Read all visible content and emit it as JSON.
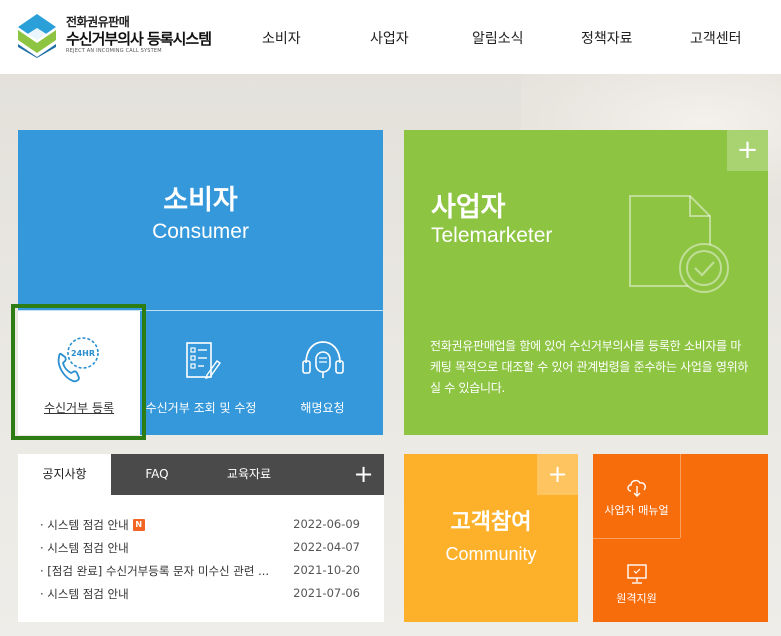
{
  "header": {
    "logo_small": "전화권유판매",
    "logo_main": "수신거부의사 등록시스템",
    "logo_eng": "REJECT AN INCOMING CALL SYSTEM",
    "nav": [
      "소비자",
      "사업자",
      "알림소식",
      "정책자료",
      "고객센터"
    ]
  },
  "consumer": {
    "title": "소비자",
    "subtitle": "Consumer",
    "buttons": [
      {
        "label": "수신거부 등록",
        "icon": "phone-24hr-icon"
      },
      {
        "label": "수신거부 조회 및 수정",
        "icon": "checklist-icon"
      },
      {
        "label": "해명요청",
        "icon": "headset-icon"
      }
    ],
    "icon_text": "24HR"
  },
  "business": {
    "title": "사업자",
    "subtitle": "Telemarketer",
    "plus": "+",
    "description": "전화권유판매업을 함에 있어 수신거부의사를 등록한 소비자를 마케팅 목적으로 대조할 수 있어 관계법령을 준수하는 사업을 영위하실 수 있습니다."
  },
  "notice": {
    "tabs": [
      "공지사항",
      "FAQ",
      "교육자료"
    ],
    "plus": "+",
    "new_badge": "N",
    "items": [
      {
        "title": "· 시스템 점검 안내",
        "date": "2022-06-09",
        "is_new": true
      },
      {
        "title": "· 시스템 점검 안내",
        "date": "2022-04-07",
        "is_new": false
      },
      {
        "title": "· [점검 완료] 수신거부등록 문자 미수신 관련 ...",
        "date": "2021-10-20",
        "is_new": false
      },
      {
        "title": "· 시스템 점검 안내",
        "date": "2021-07-06",
        "is_new": false
      }
    ]
  },
  "community": {
    "title": "고객참여",
    "subtitle": "Community",
    "plus": "+"
  },
  "manual": {
    "items": [
      {
        "label": "사업자 매뉴얼",
        "icon": "cloud-download-icon"
      },
      {
        "label": "원격지원",
        "icon": "monitor-icon"
      }
    ]
  },
  "colors": {
    "consumer": "#3498db",
    "business": "#8dc442",
    "community": "#fdb12a",
    "manual": "#f76d0c",
    "highlight": "#2e7d14",
    "new_badge": "#f26522"
  }
}
